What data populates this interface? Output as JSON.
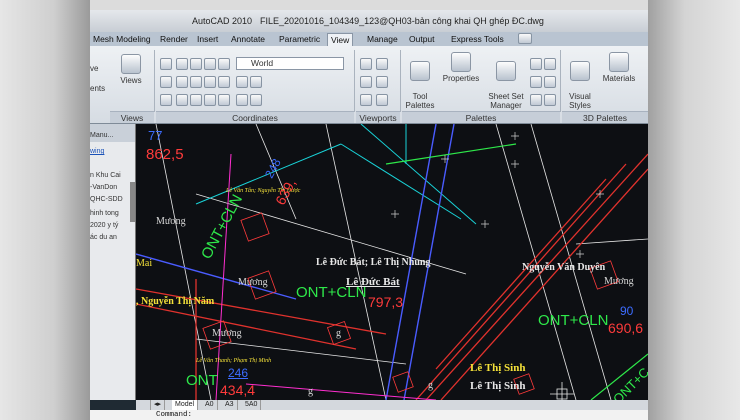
{
  "window": {
    "app": "AutoCAD 2010",
    "file": "FILE_20201016_104349_123@QH03-bản công khai QH ghép ĐC.dwg"
  },
  "tabs": [
    "Mesh Modeling",
    "Render",
    "Insert",
    "Annotate",
    "Parametric",
    "View",
    "Manage",
    "Output",
    "Express Tools"
  ],
  "active_tab": "View",
  "ribbon": {
    "views_label": "Views",
    "views_panel": "Views",
    "coords_panel": "Coordinates",
    "ucs_value": "World",
    "viewports_panel": "Viewports",
    "palettes_panel": "Palettes",
    "tool_palettes": "Tool\nPalettes",
    "properties": "Properties",
    "sheet_set": "Sheet Set\nManager",
    "visual_styles": "Visual\nStyles",
    "materials": "Materials",
    "d3_panel": "3D Palettes",
    "left_stub1": "ve",
    "left_stub2": "ents"
  },
  "left_palette": {
    "items": [
      "Manu...",
      "wing",
      "n Khu Cai",
      "-VanDon",
      "QHC-SDD",
      "hinh tong",
      "2020 y tý",
      "ác du an"
    ]
  },
  "drawing": {
    "labels": {
      "top_num": "77",
      "top_area": "862,5",
      "owner_small_1": "Lê Văn Tân; Nguyễn Thị Được",
      "mang1": "Mương",
      "code1": "ONT+CLN",
      "num1": "248",
      "area1": "639,",
      "mai": "Mai",
      "mang2": "Mương",
      "owner_main": "Lê Đức Bát; Lê Thị Nhung",
      "owner_main2": "Lê Đức Bát",
      "code2": "ONT+CLN",
      "area2": "797,3",
      "nam": ", Nguyễn Thị Năm",
      "mang3": "Mương",
      "g1": "g",
      "owner_right": "Nguyễn Văn Duyên",
      "mang4": "Mương",
      "code3": "ONT+CLN",
      "num3": "90",
      "area3": "690,6",
      "owner_small_2": "Lê Văn Thanh; Phạm Thị Minh",
      "code4": "ONT",
      "num4": "246",
      "area4": "434,4",
      "g2": "g",
      "g3": "g",
      "owner_sinh1": "Lê Thị Sinh",
      "owner_sinh2": "Lê Thị Sinh",
      "cut": "ONT+C"
    }
  },
  "layout_tabs": [
    "Model",
    "A0",
    "A3",
    "5A0"
  ],
  "active_layout": "Model",
  "command": "Command:",
  "colors": {
    "green_code": "#2ee84a",
    "red_area": "#ff3b3b",
    "blue_num": "#3c6cff",
    "yellow_owner": "#f5e23a",
    "cyan_line": "#19d3d8",
    "red_road": "#e0322d"
  }
}
